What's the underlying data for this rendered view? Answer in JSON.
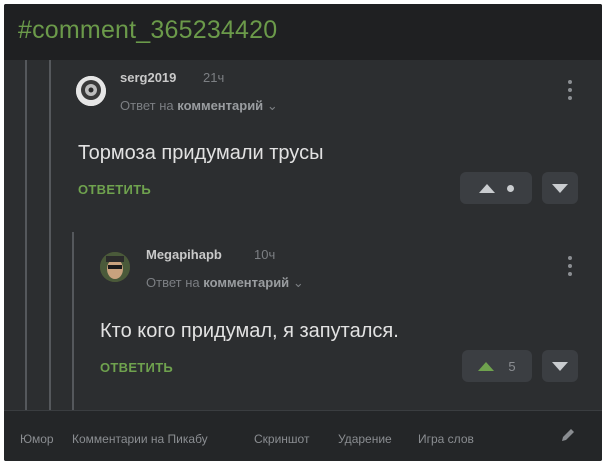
{
  "header": {
    "tag": "#comment_365234420"
  },
  "comments": [
    {
      "username": "serg2019",
      "time": "21ч",
      "reply_prefix": "Ответ на",
      "reply_target": "комментарий",
      "reply_chevron": "⌄",
      "text": "Тормоза придумали трусы",
      "answer_label": "ОТВЕТИТЬ",
      "rating": null
    },
    {
      "username": "Megapihapb",
      "time": "10ч",
      "reply_prefix": "Ответ на",
      "reply_target": "комментарий",
      "reply_chevron": "⌄",
      "text": "Кто кого придумал, я запутался.",
      "answer_label": "ОТВЕТИТЬ",
      "rating": "5"
    }
  ],
  "footer": {
    "links": [
      "Юмор",
      "Комментарии на Пикабу",
      "Скриншот",
      "Ударение",
      "Игра слов"
    ]
  },
  "colors": {
    "background": "#2c2e30",
    "accent_green": "#6fa24e",
    "text": "#e2e2e2",
    "muted": "#7c7f83"
  },
  "icons": [
    "more-vertical-icon",
    "upvote-arrow-icon",
    "downvote-arrow-icon",
    "pencil-icon"
  ]
}
